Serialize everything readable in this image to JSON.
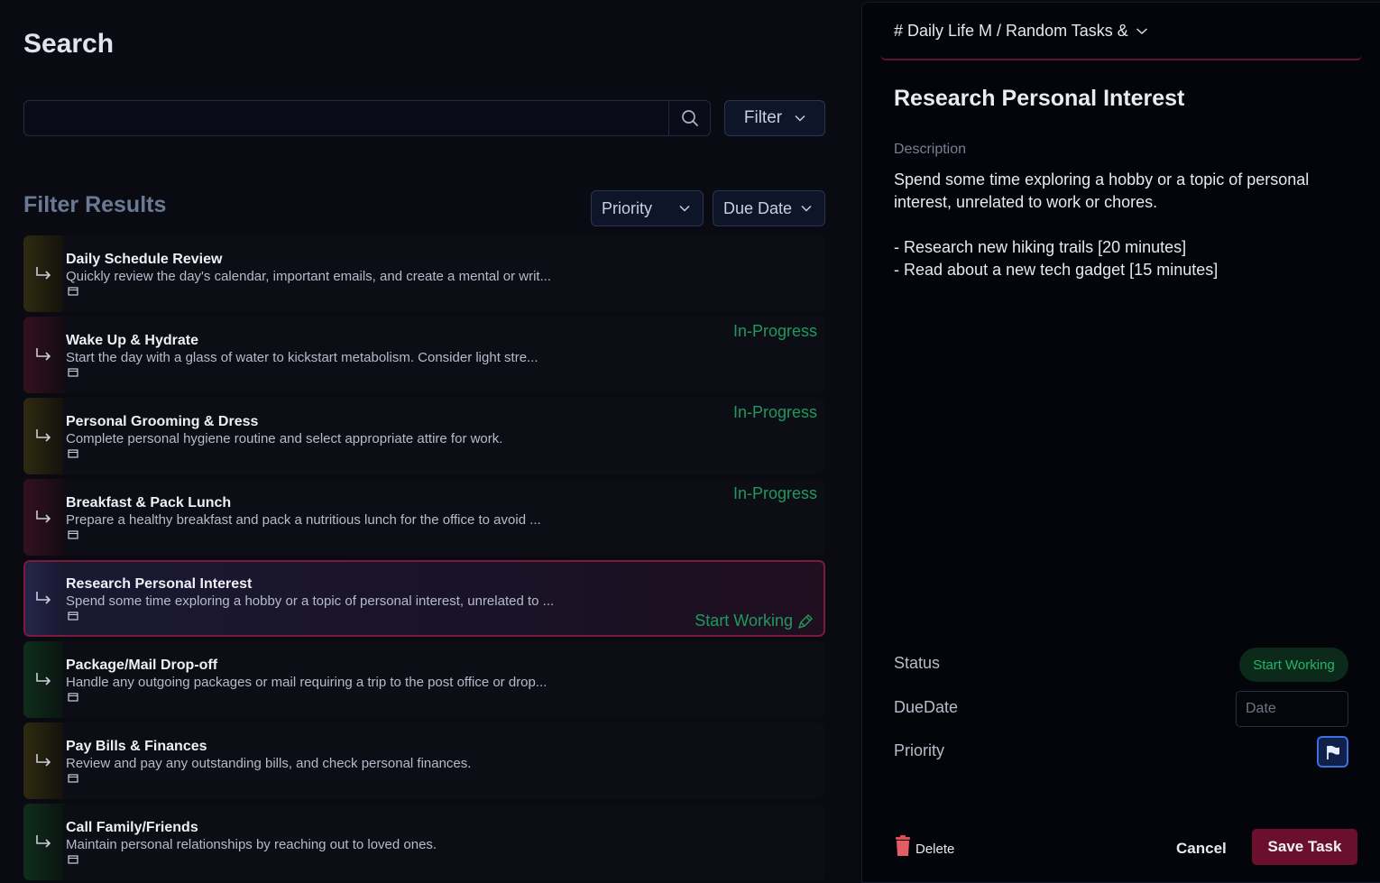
{
  "search": {
    "title": "Search",
    "input_value": "",
    "filter_label": "Filter"
  },
  "results": {
    "title": "Filter Results",
    "sort_priority_label": "Priority",
    "sort_due_label": "Due Date"
  },
  "tasks": [
    {
      "title": "Daily Schedule Review",
      "description": "Quickly review the day's calendar, important emails, and create a mental or writ...",
      "status": "",
      "color": "yellow"
    },
    {
      "title": "Wake Up & Hydrate",
      "description": "Start the day with a glass of water to kickstart metabolism. Consider light stre...",
      "status": "In-Progress",
      "color": "red"
    },
    {
      "title": "Personal Grooming & Dress",
      "description": "Complete personal hygiene routine and select appropriate attire for work.",
      "status": "In-Progress",
      "color": "yellow"
    },
    {
      "title": "Breakfast & Pack Lunch",
      "description": "Prepare a healthy breakfast and pack a nutritious lunch for the office to avoid ...",
      "status": "In-Progress",
      "color": "red"
    },
    {
      "title": "Research Personal Interest",
      "description": "Spend some time exploring a hobby or a topic of personal interest, unrelated to ...",
      "status": "Start Working",
      "color": "blue"
    },
    {
      "title": "Package/Mail Drop-off",
      "description": "Handle any outgoing packages or mail requiring a trip to the post office or drop...",
      "status": "",
      "color": "green"
    },
    {
      "title": "Pay Bills & Finances",
      "description": "Review and pay any outstanding bills, and check personal finances.",
      "status": "",
      "color": "yellow"
    },
    {
      "title": "Call Family/Friends",
      "description": "Maintain personal relationships by reaching out to loved ones.",
      "status": "",
      "color": "green"
    }
  ],
  "detail": {
    "breadcrumb": "# Daily Life M / Random Tasks &",
    "title": "Research Personal Interest",
    "description_label": "Description",
    "description": "Spend some time exploring a hobby or a topic of personal interest, unrelated to work or chores.\n\n- Research new hiking trails [20 minutes]\n- Read about a new tech gadget [15 minutes]",
    "status_label": "Status",
    "status_value": "Start Working",
    "duedate_label": "DueDate",
    "date_placeholder": "Date",
    "priority_label": "Priority",
    "delete_label": "Delete",
    "cancel_label": "Cancel",
    "save_label": "Save Task"
  },
  "colors": {
    "accent": "#6a0f2e",
    "status_green": "#1f9a5e",
    "priority_blue": "#3c6fe0"
  }
}
